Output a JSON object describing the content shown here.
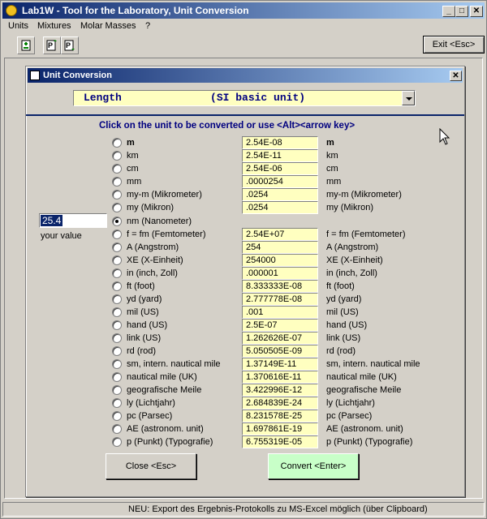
{
  "window": {
    "title": "Lab1W - Tool for the Laboratory, Unit Conversion",
    "min": "_",
    "max": "□",
    "close": "✕"
  },
  "menu": [
    "Units",
    "Mixtures",
    "Molar Masses",
    "?"
  ],
  "toolbar": {
    "exit_label": "Exit <Esc>"
  },
  "dialog": {
    "title": "Unit Conversion",
    "close": "✕",
    "quantity_select": "Length              (SI basic unit)",
    "instruction": "Click on the unit to be converted or use <Alt><arrow key>",
    "input_value": "25.4",
    "input_label": "your value",
    "units": [
      {
        "label": "m",
        "value": "2.54E-08",
        "unit": "m",
        "bold": true,
        "selected": false
      },
      {
        "label": "km",
        "value": "2.54E-11",
        "unit": "km",
        "selected": false
      },
      {
        "label": "cm",
        "value": "2.54E-06",
        "unit": "cm",
        "selected": false
      },
      {
        "label": "mm",
        "value": ".0000254",
        "unit": "mm",
        "selected": false
      },
      {
        "label": "my-m (Mikrometer)",
        "value": ".0254",
        "unit": "my-m (Mikrometer)",
        "selected": false
      },
      {
        "label": "my (Mikron)",
        "value": ".0254",
        "unit": "my (Mikron)",
        "selected": false
      },
      {
        "label": "nm (Nanometer)",
        "value": "",
        "unit": "",
        "selected": true
      },
      {
        "label": "f = fm (Femtometer)",
        "value": "2.54E+07",
        "unit": "f = fm (Femtometer)",
        "selected": false
      },
      {
        "label": "A (Angstrom)",
        "value": "254",
        "unit": "A (Angstrom)",
        "selected": false
      },
      {
        "label": "XE (X-Einheit)",
        "value": "254000",
        "unit": "XE (X-Einheit)",
        "selected": false
      },
      {
        "label": "in (inch, Zoll)",
        "value": ".000001",
        "unit": "in (inch, Zoll)",
        "selected": false
      },
      {
        "label": "ft (foot)",
        "value": "8.333333E-08",
        "unit": "ft (foot)",
        "selected": false
      },
      {
        "label": "yd (yard)",
        "value": "2.777778E-08",
        "unit": "yd (yard)",
        "selected": false
      },
      {
        "label": "mil (US)",
        "value": ".001",
        "unit": "mil (US)",
        "selected": false
      },
      {
        "label": "hand (US)",
        "value": "2.5E-07",
        "unit": "hand (US)",
        "selected": false
      },
      {
        "label": "link (US)",
        "value": "1.262626E-07",
        "unit": "link (US)",
        "selected": false
      },
      {
        "label": "rd (rod)",
        "value": "5.050505E-09",
        "unit": "rd (rod)",
        "selected": false
      },
      {
        "label": "sm, intern. nautical mile",
        "value": "1.37149E-11",
        "unit": "sm, intern. nautical mile",
        "selected": false
      },
      {
        "label": "nautical mile (UK)",
        "value": "1.370616E-11",
        "unit": "nautical mile (UK)",
        "selected": false
      },
      {
        "label": "geografische Meile",
        "value": "3.422996E-12",
        "unit": "geografische Meile",
        "selected": false
      },
      {
        "label": "ly (Lichtjahr)",
        "value": "2.684839E-24",
        "unit": "ly (Lichtjahr)",
        "selected": false
      },
      {
        "label": "pc (Parsec)",
        "value": "8.231578E-25",
        "unit": "pc (Parsec)",
        "selected": false
      },
      {
        "label": "AE (astronom. unit)",
        "value": "1.697861E-19",
        "unit": "AE (astronom. unit)",
        "selected": false
      },
      {
        "label": "p (Punkt)  (Typografie)",
        "value": "6.755319E-05",
        "unit": "p (Punkt)  (Typografie)",
        "selected": false
      }
    ],
    "close_button": "Close <Esc>",
    "convert_button": "Convert <Enter>"
  },
  "status": "NEU: Export des Ergebnis-Protokolls zu MS-Excel möglich (über Clipboard)",
  "colors": {
    "title_active": "#0a246a",
    "value_field": "#ffffc0",
    "convert_button": "#c8ffc8",
    "instruction": "#000080"
  },
  "icons": [
    "app-icon",
    "toolbar-button-1-icon",
    "toolbar-button-2-icon",
    "toolbar-button-3-icon",
    "dialog-icon",
    "mouse-cursor-icon"
  ]
}
